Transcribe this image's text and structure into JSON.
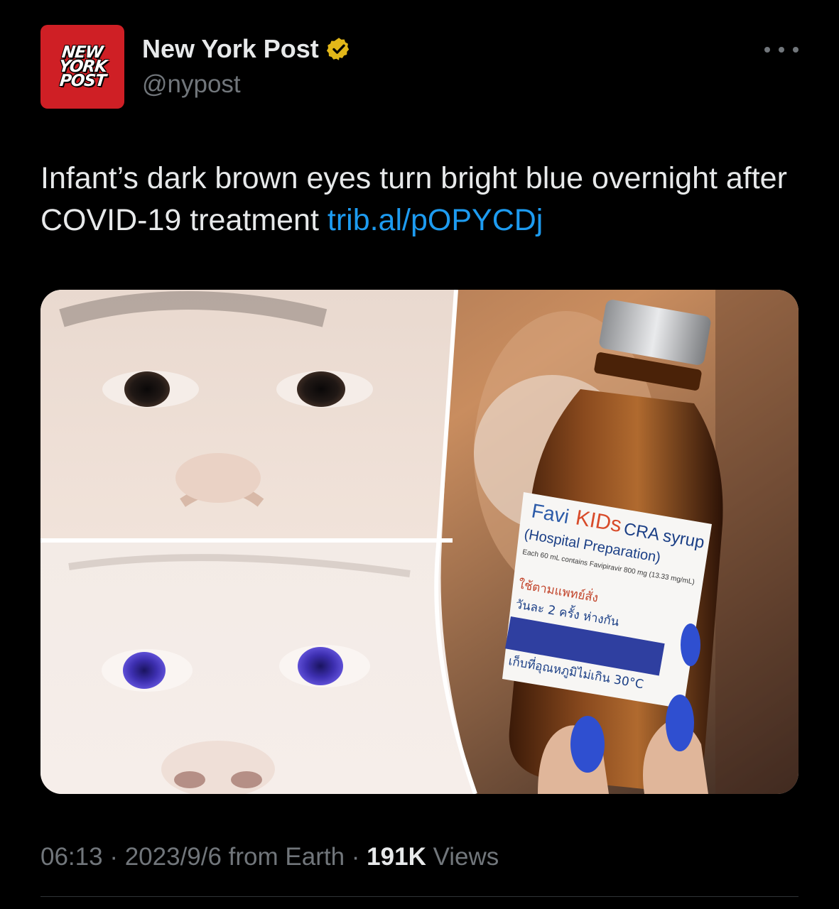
{
  "author": {
    "avatar_lines": [
      "NEW",
      "YORK",
      "POST"
    ],
    "display_name": "New York Post",
    "handle": "@nypost",
    "verified_badge_icon": "verified-gold-badge-icon"
  },
  "more_icon": "more-horizontal-icon",
  "tweet": {
    "text": "Infant’s dark brown eyes turn bright blue overnight after COVID-19 treatment ",
    "link": "trib.al/pOPYCDj"
  },
  "media": {
    "bottle_label": {
      "brand_a": "Favi",
      "brand_b": "KIDs",
      "product": "CRA syrup",
      "subtitle": "(Hospital Preparation)",
      "dose_line": "Each 60 mL contains Favipiravir 800 mg (13.33 mg/mL)",
      "thai_line_1": "ใช้ตามแพทย์สั่ง",
      "thai_line_2": "วันละ 2 ครั้ง ห่างกัน",
      "thai_line_3": "เก็บที่อุณหภูมิไม่เกิน 30°C"
    }
  },
  "meta": {
    "time": "06:13",
    "sep1": " · ",
    "date": "2023/9/6",
    "source": " from Earth",
    "sep2": " · ",
    "views_count": "191K",
    "views_label": " Views"
  },
  "colors": {
    "background": "#000000",
    "text_primary": "#e7e9ea",
    "text_secondary": "#71767b",
    "link": "#1d9bf0",
    "avatar_bg": "#cf1f25",
    "verified_gold": "#e2b719"
  }
}
